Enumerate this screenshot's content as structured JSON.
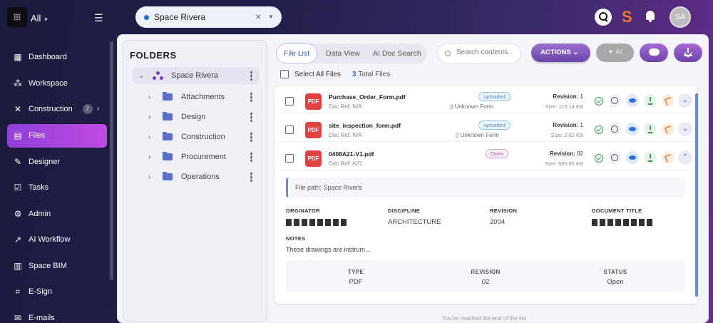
{
  "topbar": {
    "workspace": "All",
    "project": "Space Rivera",
    "brand": "S",
    "avatar": "SA"
  },
  "sidebar": {
    "items": [
      {
        "label": "Dashboard",
        "icon": "grid-icon"
      },
      {
        "label": "Workspace",
        "icon": "workspace-icon"
      },
      {
        "label": "Construction",
        "icon": "tools-icon",
        "badge": "2"
      },
      {
        "label": "Files",
        "icon": "file-icon",
        "active": true
      },
      {
        "label": "Designer",
        "icon": "design-icon"
      },
      {
        "label": "Tasks",
        "icon": "tasks-icon"
      },
      {
        "label": "Admin",
        "icon": "admin-icon"
      },
      {
        "label": "AI Workflow",
        "icon": "workflow-icon"
      },
      {
        "label": "Space BIM",
        "icon": "bim-icon"
      },
      {
        "label": "E-Sign",
        "icon": "sign-icon"
      },
      {
        "label": "E-mails",
        "icon": "mail-icon"
      }
    ]
  },
  "folders": {
    "title": "FOLDERS",
    "root": "Space Rivera",
    "items": [
      "Attachments",
      "Design",
      "Construction",
      "Procurement",
      "Operations"
    ]
  },
  "toolbar": {
    "tabs": [
      "File List",
      "Data View",
      "AI Doc Search"
    ],
    "search_placeholder": "Search contents..",
    "actions_label": "ACTIONS",
    "ai_label": "AI",
    "select_all": "Select All Files",
    "total_count": "3",
    "total_label": "Total Files"
  },
  "files": [
    {
      "name": "Purchase_Order_Form.pdf",
      "docref": "Doc Ref: N/A",
      "status": "uploaded",
      "form": "Unknown Form",
      "revision_label": "Revision:",
      "revision": "1",
      "size": "Size: 115.14 KB",
      "type": "PDF"
    },
    {
      "name": "site_inspection_form.pdf",
      "docref": "Doc Ref: N/A",
      "status": "uploaded",
      "form": "Unknown Form",
      "revision_label": "Revision:",
      "revision": "1",
      "size": "Size: 2.62 KB",
      "type": "PDF"
    },
    {
      "name": "0408A21-V1.pdf",
      "docref": "Doc Ref: A21",
      "status": "Open",
      "form": "",
      "revision_label": "Revision:",
      "revision": "02",
      "size": "Size: 665.85 KB",
      "type": "PDF"
    }
  ],
  "detail": {
    "file_path": "File path: Space Rivera",
    "labels": {
      "originator": "ORGINATOR",
      "discipline": "DISCIPLINE",
      "revision": "REVISION",
      "title": "DOCUMENT TITLE",
      "notes": "NOTES"
    },
    "discipline": "ARCHITECTURE",
    "revision": "2004",
    "notes": "These drawings are instrum...",
    "info_labels": {
      "type": "TYPE",
      "revision": "REVISION",
      "status": "STATUS"
    },
    "info": {
      "type": "PDF",
      "revision": "02",
      "status": "Open"
    }
  },
  "footer": {
    "end_text": "You've reached the end of the list"
  }
}
